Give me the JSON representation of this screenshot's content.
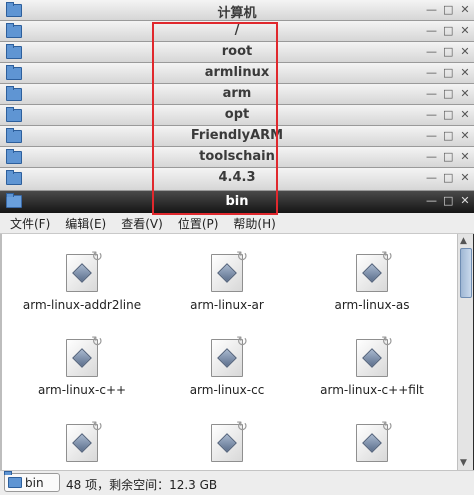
{
  "top_window": {
    "title": "计算机"
  },
  "stacked_windows": [
    {
      "title": "/"
    },
    {
      "title": "root"
    },
    {
      "title": "armlinux"
    },
    {
      "title": "arm"
    },
    {
      "title": "opt"
    },
    {
      "title": "FriendlyARM"
    },
    {
      "title": "toolschain"
    },
    {
      "title": "4.4.3"
    }
  ],
  "active_window": {
    "title": "bin"
  },
  "window_controls": {
    "minimize": "—",
    "maximize": "□",
    "close": "✕"
  },
  "menubar": [
    "文件(F)",
    "编辑(E)",
    "查看(V)",
    "位置(P)",
    "帮助(H)"
  ],
  "files": [
    {
      "name": "arm-linux-addr2line"
    },
    {
      "name": "arm-linux-ar"
    },
    {
      "name": "arm-linux-as"
    },
    {
      "name": "arm-linux-c++"
    },
    {
      "name": "arm-linux-cc"
    },
    {
      "name": "arm-linux-c++filt"
    }
  ],
  "statusbar": {
    "location": "bin",
    "info": "48 项，剩余空间：12.3 GB"
  },
  "colors": {
    "highlight_box": "#e0282d",
    "folder_icon": "#5f95d3"
  }
}
